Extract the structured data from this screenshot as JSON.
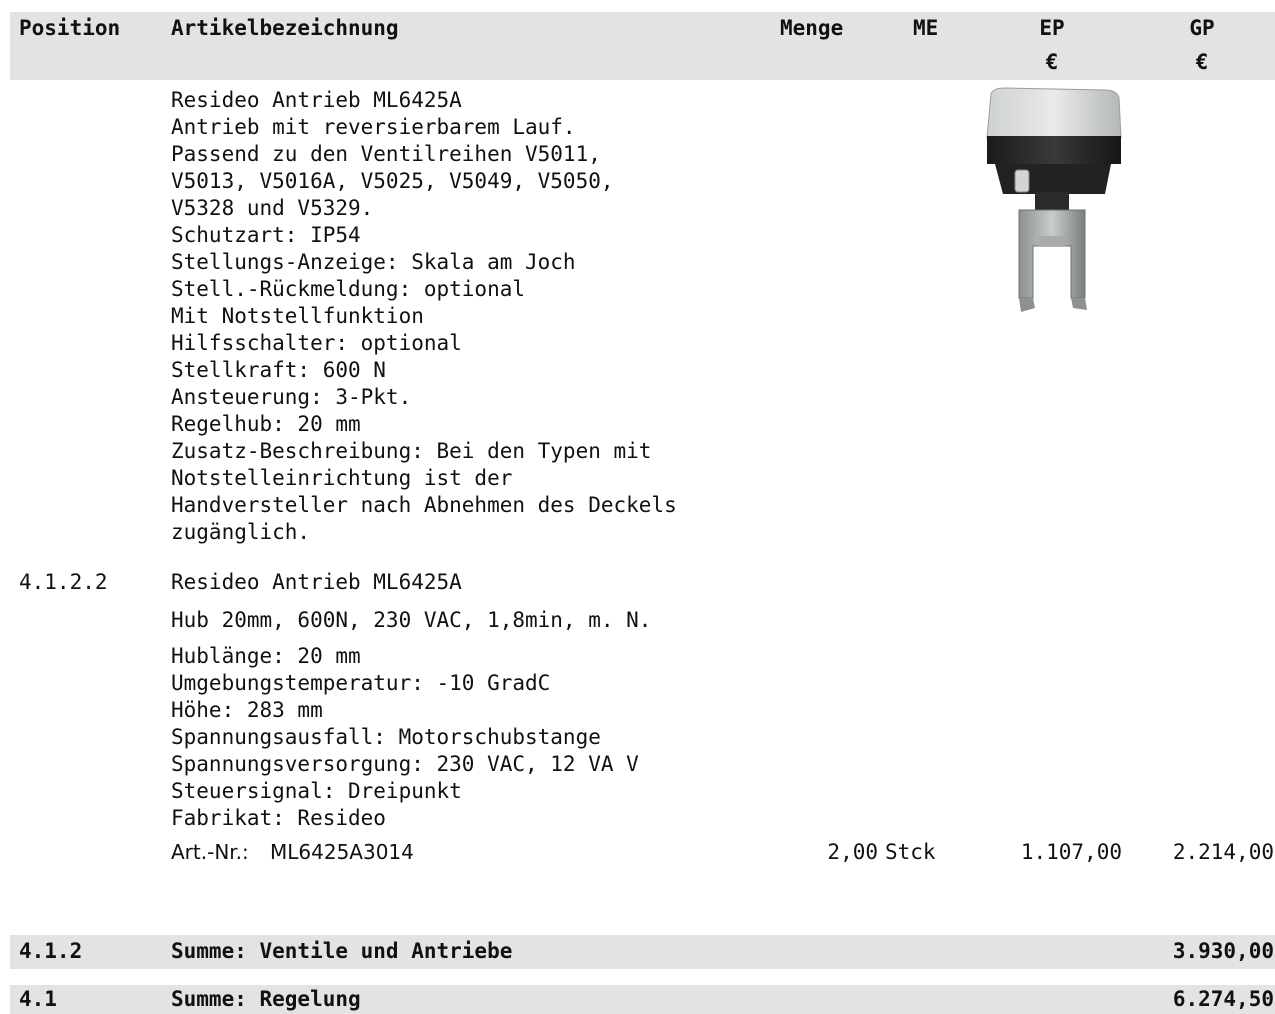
{
  "header": {
    "position": "Position",
    "artikel": "Artikelbezeichnung",
    "menge": "Menge",
    "me": "ME",
    "ep": "EP",
    "ep_currency": "€",
    "gp": "GP",
    "gp_currency": "€"
  },
  "long_text": [
    "Resideo Antrieb ML6425A",
    "Antrieb mit reversierbarem Lauf.",
    "Passend zu den Ventilreihen V5011,",
    "V5013, V5016A, V5025, V5049, V5050,",
    "V5328 und V5329.",
    "Schutzart: IP54",
    "Stellungs-Anzeige: Skala am Joch",
    "Stell.-Rückmeldung: optional",
    "Mit Notstellfunktion",
    "Hilfsschalter: optional",
    "Stellkraft: 600 N",
    "Ansteuerung: 3-Pkt.",
    "Regelhub: 20 mm",
    "Zusatz-Beschreibung: Bei den Typen mit",
    "Notstelleinrichtung ist der",
    "Handversteller nach Abnehmen des Deckels",
    "zugänglich."
  ],
  "item": {
    "position": "4.1.2.2",
    "title": "Resideo Antrieb ML6425A",
    "subtitle": "Hub 20mm, 600N, 230 VAC, 1,8min, m. N.",
    "specs": [
      "Hublänge: 20 mm",
      "Umgebungstemperatur: -10 GradC",
      "Höhe: 283 mm",
      "Spannungsausfall: Motorschubstange",
      "Spannungsversorgung: 230 VAC, 12 VA V",
      "Steuersignal: Dreipunkt",
      "Fabrikat: Resideo"
    ],
    "art_label": "Art.-Nr.:",
    "art_nr": "ML6425A3014",
    "menge": "2,00",
    "me": "Stck",
    "ep": "1.107,00",
    "gp": "2.214,00"
  },
  "sums": [
    {
      "position": "4.1.2",
      "label": "Summe: Ventile und Antriebe",
      "total": "3.930,00"
    },
    {
      "position": "4.1",
      "label": "Summe: Regelung",
      "total": "6.274,50"
    }
  ],
  "image": {
    "icon": "valve-actuator-product-image"
  }
}
